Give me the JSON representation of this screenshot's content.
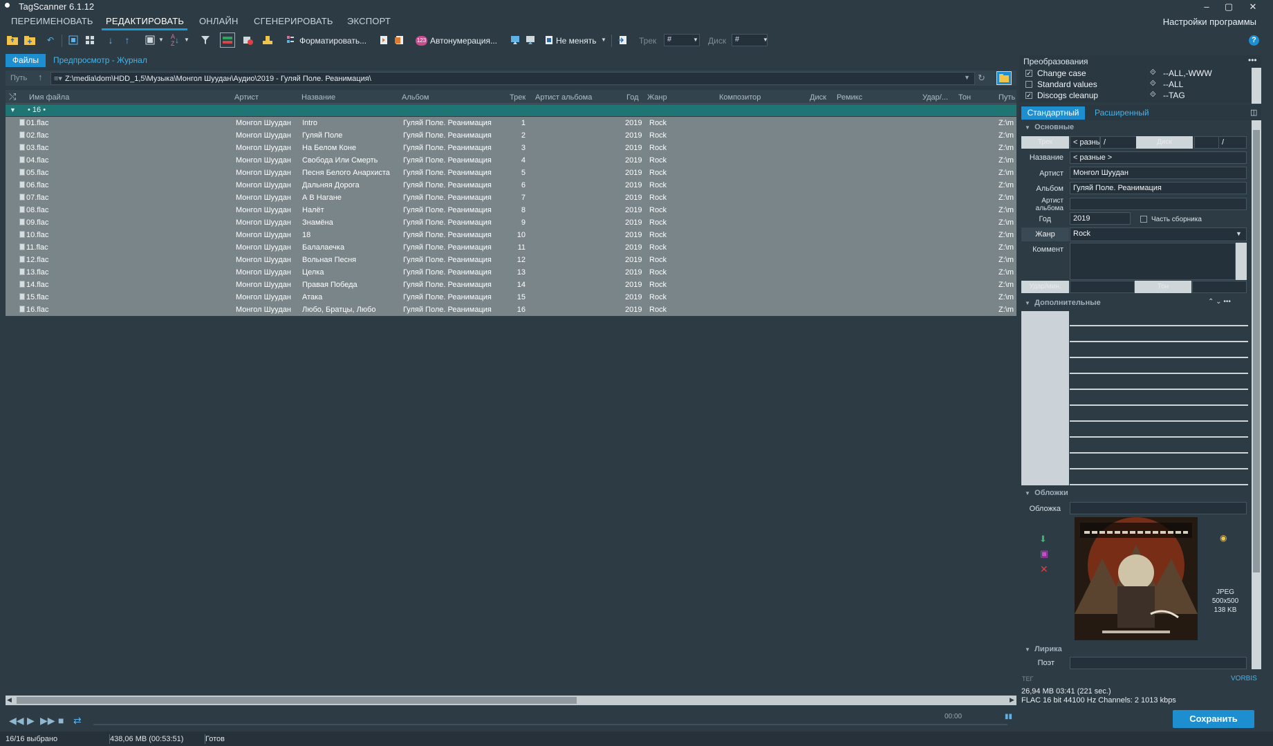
{
  "window": {
    "title": "TagScanner 6.1.12"
  },
  "main_menu": {
    "items": [
      "ПЕРЕИМЕНОВАТЬ",
      "РЕДАКТИРОВАТЬ",
      "ОНЛАЙН",
      "СГЕНЕРИРОВАТЬ",
      "ЭКСПОРТ"
    ],
    "active": "РЕДАКТИРОВАТЬ",
    "settings": "Настройки программы"
  },
  "toolbar": {
    "format_label": "Форматировать...",
    "autonum_badge": "123",
    "autonum_label": "Автонумерация...",
    "nochange_label": "Не менять",
    "track_label": "Трек",
    "track_value": "#",
    "disc_label": "Диск",
    "disc_value": "#",
    "help": "?"
  },
  "left_tabs": {
    "files": "Файлы",
    "preview": "Предпросмотр - Журнал"
  },
  "path": {
    "label": "Путь",
    "value": "Z:\\media\\dom\\HDD_1,5\\Музыка\\Монгол Шуудан\\Аудио\\2019 - Гуляй Поле. Реанимация\\"
  },
  "grid": {
    "columns": [
      "Имя файла",
      "Артист",
      "Название",
      "Альбом",
      "Трек",
      "Артист альбома",
      "Год",
      "Жанр",
      "Композитор",
      "Диск",
      "Ремикс",
      "Удар/...",
      "Тон",
      "Путь"
    ],
    "group_label": "• 16 •",
    "rows": [
      {
        "file": "01.flac",
        "artist": "Монгол Шуудан",
        "title": "Intro",
        "album": "Гуляй Поле. Реанимация",
        "track": "1",
        "year": "2019",
        "genre": "Rock",
        "path": "Z:\\m"
      },
      {
        "file": "02.flac",
        "artist": "Монгол Шуудан",
        "title": "Гуляй Поле",
        "album": "Гуляй Поле. Реанимация",
        "track": "2",
        "year": "2019",
        "genre": "Rock",
        "path": "Z:\\m"
      },
      {
        "file": "03.flac",
        "artist": "Монгол Шуудан",
        "title": "На Белом Коне",
        "album": "Гуляй Поле. Реанимация",
        "track": "3",
        "year": "2019",
        "genre": "Rock",
        "path": "Z:\\m"
      },
      {
        "file": "04.flac",
        "artist": "Монгол Шуудан",
        "title": "Свобода Или Смерть",
        "album": "Гуляй Поле. Реанимация",
        "track": "4",
        "year": "2019",
        "genre": "Rock",
        "path": "Z:\\m"
      },
      {
        "file": "05.flac",
        "artist": "Монгол Шуудан",
        "title": "Песня Белого Анархиста",
        "album": "Гуляй Поле. Реанимация",
        "track": "5",
        "year": "2019",
        "genre": "Rock",
        "path": "Z:\\m"
      },
      {
        "file": "06.flac",
        "artist": "Монгол Шуудан",
        "title": "Дальняя Дорога",
        "album": "Гуляй Поле. Реанимация",
        "track": "6",
        "year": "2019",
        "genre": "Rock",
        "path": "Z:\\m"
      },
      {
        "file": "07.flac",
        "artist": "Монгол Шуудан",
        "title": "А В Нагане",
        "album": "Гуляй Поле. Реанимация",
        "track": "7",
        "year": "2019",
        "genre": "Rock",
        "path": "Z:\\m"
      },
      {
        "file": "08.flac",
        "artist": "Монгол Шуудан",
        "title": "Налёт",
        "album": "Гуляй Поле. Реанимация",
        "track": "8",
        "year": "2019",
        "genre": "Rock",
        "path": "Z:\\m"
      },
      {
        "file": "09.flac",
        "artist": "Монгол Шуудан",
        "title": "Знамёна",
        "album": "Гуляй Поле. Реанимация",
        "track": "9",
        "year": "2019",
        "genre": "Rock",
        "path": "Z:\\m"
      },
      {
        "file": "10.flac",
        "artist": "Монгол Шуудан",
        "title": "18",
        "album": "Гуляй Поле. Реанимация",
        "track": "10",
        "year": "2019",
        "genre": "Rock",
        "path": "Z:\\m"
      },
      {
        "file": "11.flac",
        "artist": "Монгол Шуудан",
        "title": "Балалаечка",
        "album": "Гуляй Поле. Реанимация",
        "track": "11",
        "year": "2019",
        "genre": "Rock",
        "path": "Z:\\m"
      },
      {
        "file": "12.flac",
        "artist": "Монгол Шуудан",
        "title": "Вольная Песня",
        "album": "Гуляй Поле. Реанимация",
        "track": "12",
        "year": "2019",
        "genre": "Rock",
        "path": "Z:\\m"
      },
      {
        "file": "13.flac",
        "artist": "Монгол Шуудан",
        "title": "Целка",
        "album": "Гуляй Поле. Реанимация",
        "track": "13",
        "year": "2019",
        "genre": "Rock",
        "path": "Z:\\m"
      },
      {
        "file": "14.flac",
        "artist": "Монгол Шуудан",
        "title": "Правая Победа",
        "album": "Гуляй Поле. Реанимация",
        "track": "14",
        "year": "2019",
        "genre": "Rock",
        "path": "Z:\\m"
      },
      {
        "file": "15.flac",
        "artist": "Монгол Шуудан",
        "title": "Атака",
        "album": "Гуляй Поле. Реанимация",
        "track": "15",
        "year": "2019",
        "genre": "Rock",
        "path": "Z:\\m"
      },
      {
        "file": "16.flac",
        "artist": "Монгол Шуудан",
        "title": "Любо, Братцы, Любо",
        "album": "Гуляй Поле. Реанимация",
        "track": "16",
        "year": "2019",
        "genre": "Rock",
        "path": "Z:\\m"
      }
    ]
  },
  "player": {
    "time": "00:00"
  },
  "status": {
    "selected": "16/16 выбрано",
    "size": "438,06 MB (00:53:51)",
    "state": "Готов"
  },
  "right_panel": {
    "transforms_title": "Преобразования",
    "transforms": [
      {
        "name": "Change case",
        "checked": true,
        "scope": "--ALL,-WWW"
      },
      {
        "name": "Standard values",
        "checked": false,
        "scope": "--ALL"
      },
      {
        "name": "Discogs cleanup",
        "checked": true,
        "scope": "--TAG"
      }
    ],
    "tabs": {
      "standard": "Стандартный",
      "advanced": "Расширенный"
    },
    "basic_section": "Основные",
    "fields": {
      "track_label": "Трек",
      "track_value": "< разнь",
      "disc_label": "Диск",
      "title_label": "Название",
      "title_value": "< разные >",
      "artist_label": "Артист",
      "artist_value": "Монгол Шуудан",
      "album_label": "Альбом",
      "album_value": "Гуляй Поле. Реанимация",
      "album_artist_label_1": "Артист",
      "album_artist_label_2": "альбома",
      "year_label": "Год",
      "year_value": "2019",
      "compilation_label": "Часть сборника",
      "genre_label": "Жанр",
      "genre_value": "Rock",
      "comment_label": "Коммент",
      "bpm_label": "Удар/мин.",
      "key_label": "Тон"
    },
    "extra_section": "Дополнительные",
    "covers_section": "Обложки",
    "cover_label": "Обложка",
    "cover_info": {
      "format": "JPEG",
      "dims": "500x500",
      "size": "138 KB"
    },
    "lyrics_section": "Лирика",
    "poet_label": "Поэт",
    "tag_label": "ТЕГ",
    "tag_value": "VORBIS",
    "file_info_1": "26,94 MB  03:41 (221 sec.)",
    "file_info_2": "FLAC  16 bit  44100 Hz  Channels: 2  1013 kbps",
    "save_label": "Сохранить"
  },
  "colors": {
    "accent": "#1d8fd0",
    "background": "#2d3b44",
    "selection": "#7a8589",
    "group": "#1f7574"
  }
}
